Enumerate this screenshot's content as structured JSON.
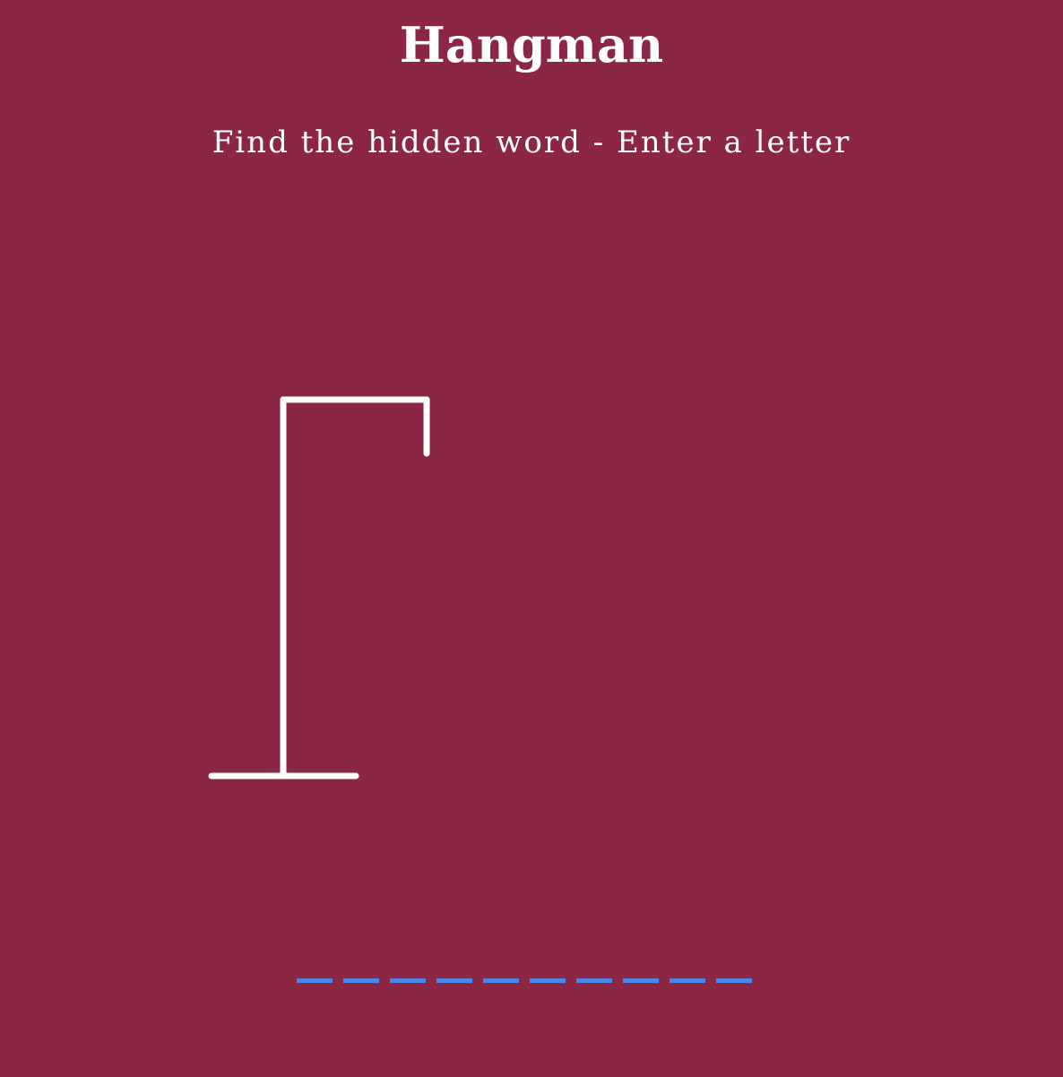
{
  "game": {
    "title": "Hangman",
    "instructions": "Find the hidden word - Enter a letter"
  },
  "word": {
    "slots": [
      "",
      "",
      "",
      "",
      "",
      "",
      "",
      "",
      "",
      ""
    ],
    "slot_color": "#4a86e8"
  },
  "colors": {
    "background": "#8c2645",
    "gallows": "#ffffff",
    "text": "#ffffff"
  }
}
